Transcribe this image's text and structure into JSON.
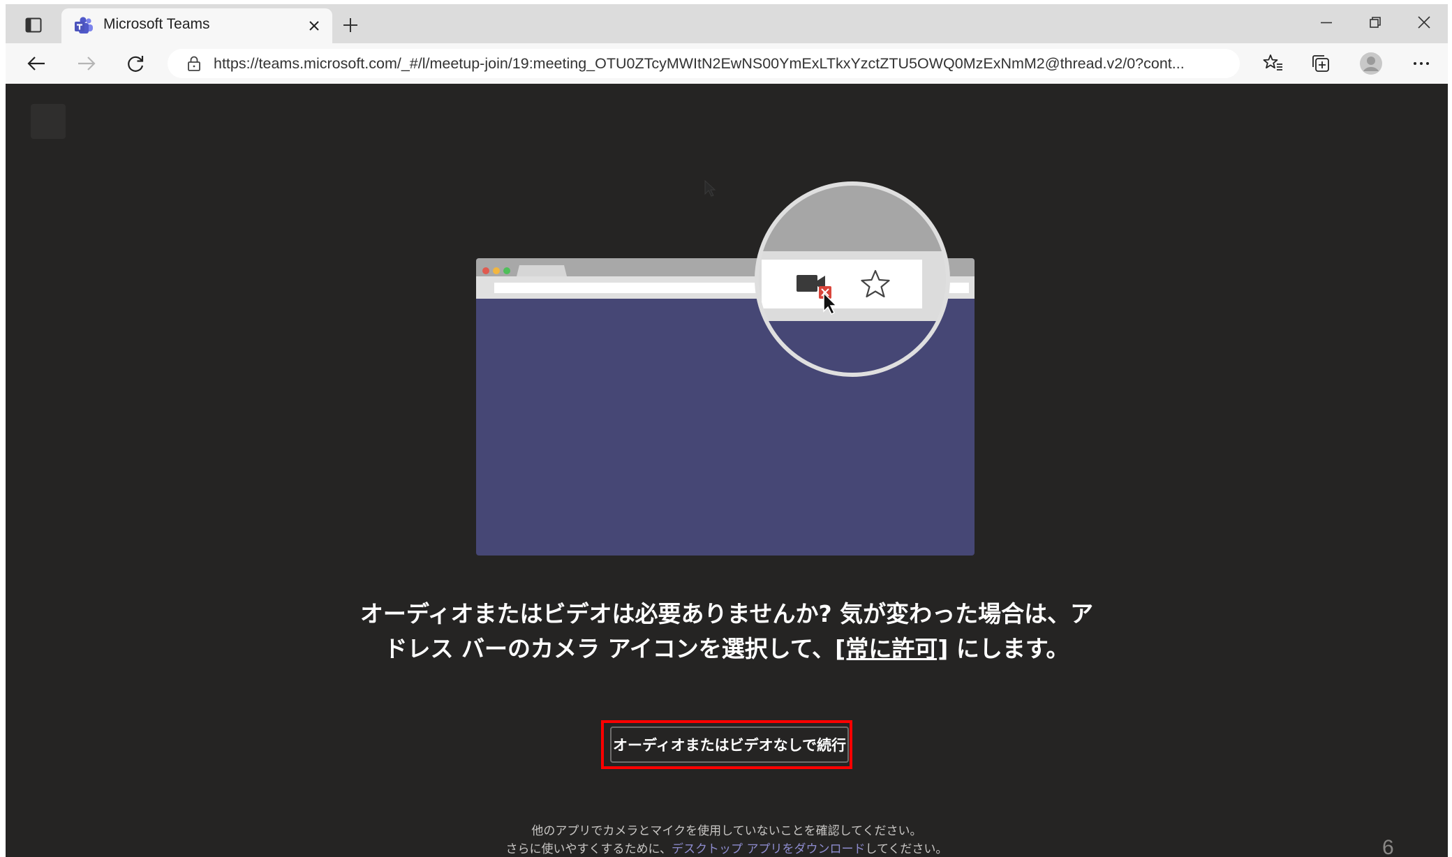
{
  "browser": {
    "tab": {
      "title": "Microsoft Teams",
      "favicon": "teams-icon"
    },
    "address_bar": {
      "url": "https://teams.microsoft.com/_#/l/meetup-join/19:meeting_OTU0ZTcyMWItN2EwNS00YmExLTkxYzctZTU5OWQ0MzExNmM2@thread.v2/0?cont..."
    },
    "icons": [
      "tab-actions-icon",
      "teams-icon",
      "close-tab-icon",
      "new-tab-icon",
      "minimize-icon",
      "restore-icon",
      "close-window-icon",
      "back-icon",
      "forward-icon",
      "refresh-icon",
      "lock-icon",
      "favorites-icon",
      "collections-icon",
      "profile-icon",
      "more-icon"
    ]
  },
  "page": {
    "message_line1": "オーディオまたはビデオは必要ありませんか? 気が変わった場合は、ア",
    "message_line2_pre": "ドレス バーのカメラ アイコンを選択して、",
    "message_line2_link": "[常に許可]",
    "message_line2_post": " にします。",
    "continue_button": "オーディオまたはビデオなしで続行",
    "footnote_line1": "他のアプリでカメラとマイクを使用していないことを確認してください。",
    "footnote_line2_pre": "さらに使いやすくするために、",
    "footnote_line2_link": "デスクトップ アプリをダウンロード",
    "footnote_line2_post": "してください。",
    "page_number": "6"
  },
  "colors": {
    "page_background": "#252423",
    "illustration_window": "#464775",
    "link": "#8e8ccf",
    "highlight_border": "#ff0000",
    "camera_blocked_badge": "#d9453b"
  }
}
